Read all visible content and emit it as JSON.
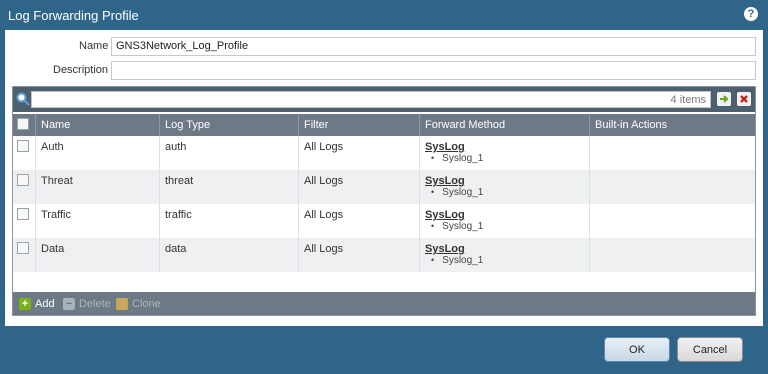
{
  "dialog": {
    "title": "Log Forwarding Profile",
    "help_icon": "question-mark-circle-icon"
  },
  "form": {
    "name_label": "Name",
    "name_value": "GNS3Network_Log_Profile",
    "description_label": "Description",
    "description_value": ""
  },
  "grid": {
    "search": {
      "value": "",
      "count_text": "4 items"
    },
    "icons": {
      "search": "magnifier-icon",
      "apply": "arrow-right-icon",
      "clear": "x-icon"
    },
    "columns": [
      "Name",
      "Log Type",
      "Filter",
      "Forward Method",
      "Built-in Actions"
    ],
    "rows": [
      {
        "name": "Auth",
        "log_type": "auth",
        "filter": "All Logs",
        "method": "SysLog",
        "sub": "Syslog_1",
        "actions": ""
      },
      {
        "name": "Threat",
        "log_type": "threat",
        "filter": "All Logs",
        "method": "SysLog",
        "sub": "Syslog_1",
        "actions": ""
      },
      {
        "name": "Traffic",
        "log_type": "traffic",
        "filter": "All Logs",
        "method": "SysLog",
        "sub": "Syslog_1",
        "actions": ""
      },
      {
        "name": "Data",
        "log_type": "data",
        "filter": "All Logs",
        "method": "SysLog",
        "sub": "Syslog_1",
        "actions": ""
      }
    ],
    "footer": {
      "add_label": "Add",
      "delete_label": "Delete",
      "clone_label": "Clone"
    }
  },
  "buttons": {
    "ok_label": "OK",
    "cancel_label": "Cancel"
  },
  "colors": {
    "frame": "#2f6588",
    "toolbar": "#4d6070",
    "header": "#6d7a85",
    "add": "#7ab317",
    "clone": "#e0b040"
  }
}
